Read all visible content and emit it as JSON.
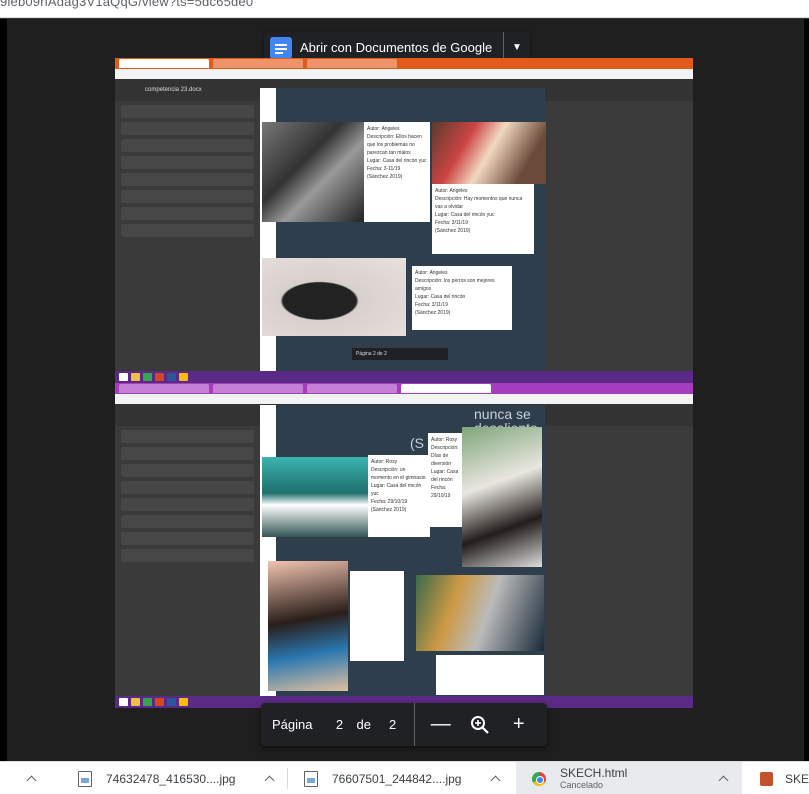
{
  "url_fragment": "9leb09rlAdag3V1aQqG/view?ts=5dc65de0",
  "open_with": {
    "label": "Abrir con Documentos de Google"
  },
  "embedded": {
    "doc_title": "competencia 23.docx",
    "page_cards": [
      {
        "text": "Autor: Angeles\nDescripción: Ellos hacen que los problemas no parezcan tan malos\nLugar: Casa del rincón yuc\nFecha: 3-11/19\n(Sánchez 2019)"
      },
      {
        "text": "Autor: Angeles\nDescripción: Hay momentos que nunca vas a olvidar\nLugar: Casa del rincón yuc\nFecha: 3/11/19\n(Sánchez 2019)"
      },
      {
        "text": "Autor: Angeles\nDescripción: los perros son mejores amigos\nLugar: Casa del rincón\nFecha: 3/11/19\n(Sánchez 2019)"
      },
      {
        "text": "Autor: Rosy\nDescripción: un momento en el gimnasio\nLugar: Casa del rincón yuc\nFecha: 29/10/19\n(Sánchez 2019)"
      },
      {
        "text": "Autor: Rosy\nDescripción: Días de diversión\nLugar: Casa del rincón\nFecha: 29/10/19"
      }
    ],
    "overlay_text_top": "nunca se desaliente",
    "overlay_letter": "(S",
    "mini_pager_label": "Página 2 de 2"
  },
  "pager": {
    "label": "Página",
    "current": "2",
    "of": "de",
    "total": "2",
    "zoom_out_symbol": "—",
    "zoom_in_symbol": "+"
  },
  "downloads": [
    {
      "filename": "74632478_416530....jpg",
      "icon": "image-file-icon"
    },
    {
      "filename": "76607501_244842....jpg",
      "icon": "image-file-icon"
    },
    {
      "filename": "SKECH.html",
      "status": "Cancelado",
      "icon": "chrome-icon"
    },
    {
      "filename": "SKE",
      "icon": "sketch-file-icon"
    }
  ],
  "colors": {
    "viewer_bg": "#323639",
    "pager_bg": "#202124",
    "docs_blue": "#4285f4",
    "taskbar_purple": "#5b2a86"
  }
}
